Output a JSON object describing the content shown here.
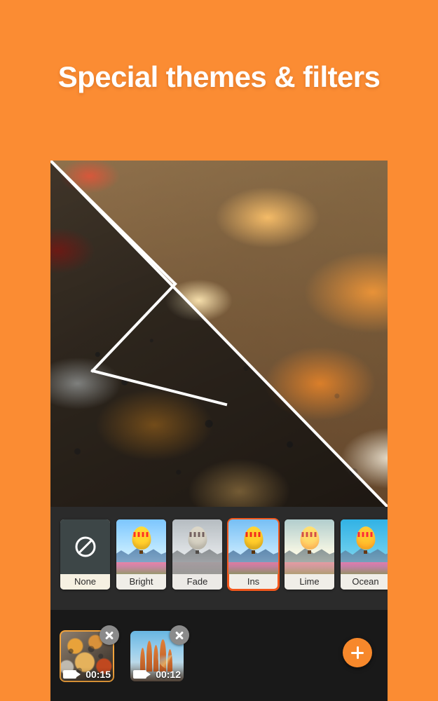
{
  "theme": {
    "background_color": "#FB8C33",
    "accent_color": "#F2571C",
    "panel_color": "#2B2B2B",
    "timeline_color": "#191919"
  },
  "headline": "Special themes & filters",
  "preview": {
    "name": "video-preview",
    "split_overlay": "diagonal-filter-compare-lines"
  },
  "filters": {
    "selected": "Ins",
    "items": [
      {
        "label": "None",
        "icon": "no-filter-icon",
        "selected": false
      },
      {
        "label": "Bright",
        "icon": "balloon-thumb",
        "selected": false
      },
      {
        "label": "Fade",
        "icon": "balloon-thumb",
        "selected": false
      },
      {
        "label": "Ins",
        "icon": "balloon-thumb",
        "selected": true
      },
      {
        "label": "Lime",
        "icon": "balloon-thumb",
        "selected": false
      },
      {
        "label": "Ocean",
        "icon": "balloon-thumb",
        "selected": false
      }
    ]
  },
  "timeline": {
    "clips": [
      {
        "duration": "00:15",
        "selected": true,
        "close_icon": "close-icon",
        "media_icon": "video-camera-icon"
      },
      {
        "duration": "00:12",
        "selected": false,
        "close_icon": "close-icon",
        "media_icon": "video-camera-icon"
      }
    ],
    "add_button": {
      "icon": "plus-icon",
      "label": "+"
    }
  }
}
